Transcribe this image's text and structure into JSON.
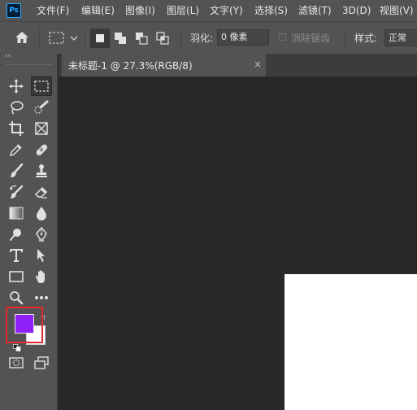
{
  "app": {
    "logo": "Ps"
  },
  "menu": {
    "file": "文件(F)",
    "edit": "编辑(E)",
    "image": "图像(I)",
    "layer": "图层(L)",
    "type": "文字(Y)",
    "select": "选择(S)",
    "filter": "滤镜(T)",
    "three_d": "3D(D)",
    "view": "视图(V)"
  },
  "options": {
    "feather_label": "羽化:",
    "feather_value": "0 像素",
    "antialias_label": "消除锯齿",
    "style_label": "样式:",
    "style_value": "正常"
  },
  "document": {
    "tab_title": "未标题-1 @ 27.3%(RGB/8)",
    "close_glyph": "×"
  },
  "toolbar": {
    "collapse_glyph": "‹‹",
    "swap_glyph": "↰"
  },
  "colors": {
    "foreground": "#8f1ff7",
    "background": "#ffffff",
    "highlight_border": "#e32a2a"
  },
  "tools": [
    "move-tool",
    "rectangular-marquee-tool",
    "lasso-tool",
    "quick-selection-tool",
    "crop-tool",
    "frame-tool",
    "eyedropper-tool",
    "spot-healing-brush-tool",
    "brush-tool",
    "clone-stamp-tool",
    "history-brush-tool",
    "eraser-tool",
    "gradient-tool",
    "blur-tool",
    "dodge-tool",
    "pen-tool",
    "type-tool",
    "path-selection-tool",
    "rectangle-tool",
    "hand-tool",
    "zoom-tool",
    "more-tools",
    "quick-mask-mode",
    "screen-mode"
  ]
}
